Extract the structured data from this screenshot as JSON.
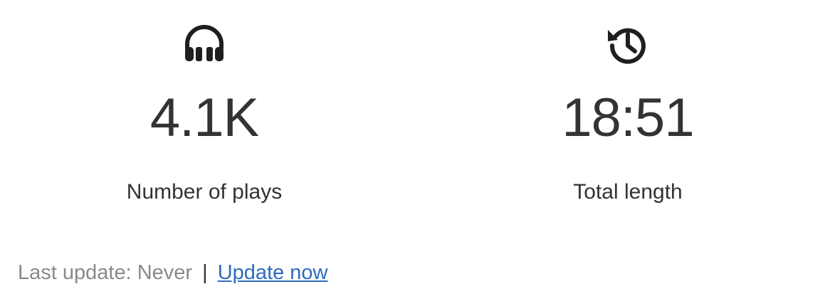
{
  "stats": [
    {
      "icon": "headphones-icon",
      "value": "4.1K",
      "label": "Number of plays"
    },
    {
      "icon": "history-icon",
      "value": "18:51",
      "label": "Total length"
    }
  ],
  "footer": {
    "last_update_label": "Last update:",
    "last_update_value": "Never",
    "separator": "|",
    "update_link": "Update now"
  },
  "colors": {
    "text": "#333333",
    "muted": "#8a8a8a",
    "link": "#2c6bbf",
    "icon": "#1f1f1f"
  }
}
